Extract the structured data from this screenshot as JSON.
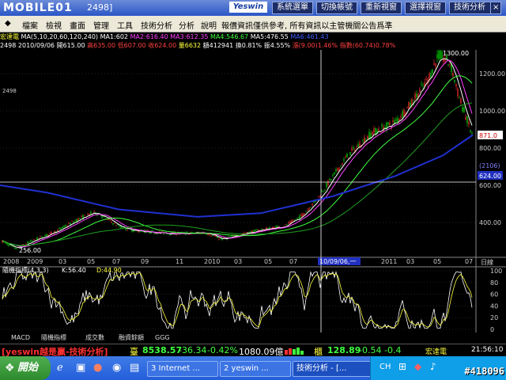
{
  "window": {
    "logo_text": "MOBILE01",
    "title": "2498]",
    "brand": "Yeswin",
    "toolbar_buttons": [
      "系統選單",
      "切換帳號",
      "重新視窗",
      "選擇視窗",
      "技術分析"
    ],
    "win_controls": [
      "_",
      "□",
      "×"
    ]
  },
  "menu": {
    "items": [
      "檔案",
      "檢視",
      "畫面",
      "管理",
      "工具",
      "技術分析",
      "分析",
      "說明"
    ],
    "notice": "報價資訊僅供參考, 所有資訊以主管機關公告爲準"
  },
  "ma_header": {
    "stock": "宏達電",
    "params": "MA(5,10,20,60,120,240)",
    "ma1": "MA1:602",
    "ma2": "MA2:616.40",
    "ma3": "MA3:612.35",
    "ma4": "MA4:546.67",
    "ma5": "MA5:476.55",
    "ma6": "MA6:461.43"
  },
  "info": {
    "code": "2498",
    "date": "2010/09/06",
    "open": "開615.00",
    "high": "高635.00",
    "low": "低607.00",
    "close": "收624.00",
    "volume": "量6632",
    "amount": "額412941",
    "turnover": "換0.81%",
    "amplitude": "振4.55%",
    "change": "漲(9.00)1.46%",
    "index": "指數(60.74)0.78%"
  },
  "price_axis": [
    "1200.00",
    "1000.00",
    "800.00",
    "600.00",
    "400.00"
  ],
  "price_markers": {
    "current": "871.0",
    "count": "(2106)",
    "cursor": "624.00",
    "high": "1300.00",
    "low": "256.00"
  },
  "date_axis": [
    "2008",
    "2009",
    "03",
    "05",
    "07",
    "09",
    "11",
    "2010",
    "03",
    "05",
    "07",
    "10/09/06,一",
    "2011",
    "03",
    "05",
    "07"
  ],
  "axis_unit": "日線",
  "indicator": {
    "name": "隨機指標(4,3,3)",
    "k": "K:56.40",
    "d": "D:44.90"
  },
  "kd_axis": [
    "100",
    "80",
    "60",
    "40",
    "20",
    "0"
  ],
  "tabs": [
    "MACD",
    "隨機指標",
    "成交數",
    "融資餘額",
    "GGG"
  ],
  "ticker": {
    "slogan": "[yeswin越是贏-技術分析]",
    "index_label": "臺",
    "index_value": "8538.57",
    "index_change": "-36.34",
    "index_pct": "-0.42%",
    "index_volume": "1080.09億",
    "otc_label": "櫃",
    "otc_value": "128.89",
    "otc_change": "-0.54",
    "otc_pct": "-0.4",
    "stock": "宏達電",
    "time": "21:56:10"
  },
  "taskbar": {
    "start": "開始",
    "tasks": [
      "3 Internet ...",
      "2 yeswin ...",
      "技術分析 - [..."
    ],
    "lang": "CH",
    "watermark": "#418096"
  },
  "colors": {
    "up": "#ff3030",
    "down": "#00e000",
    "ma_blue": "#2030d0",
    "ma_green": "#20c020",
    "grid": "#444"
  }
}
